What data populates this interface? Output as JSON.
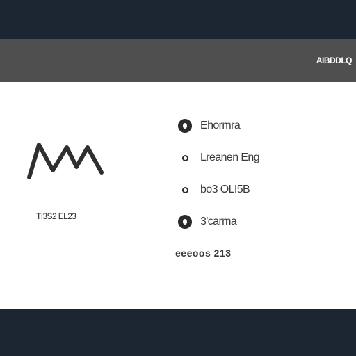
{
  "header": {
    "title": "AIBDDLQ"
  },
  "logo": {
    "icon": "wave-logo-icon",
    "caption": "TI3S2 EL23"
  },
  "options": [
    {
      "label": "Ehormra",
      "selected": true
    },
    {
      "label": "Lreanen Eng",
      "selected": false
    },
    {
      "label": "bo3 OLI5B",
      "selected": false
    },
    {
      "label": "3'carma",
      "selected": true
    }
  ],
  "footer": {
    "text": "eeeoos 213"
  },
  "colors": {
    "top_bar": "#1b2632",
    "header_bar": "#4f4f4f",
    "content": "#ffffff",
    "text": "#3a3a3a"
  }
}
